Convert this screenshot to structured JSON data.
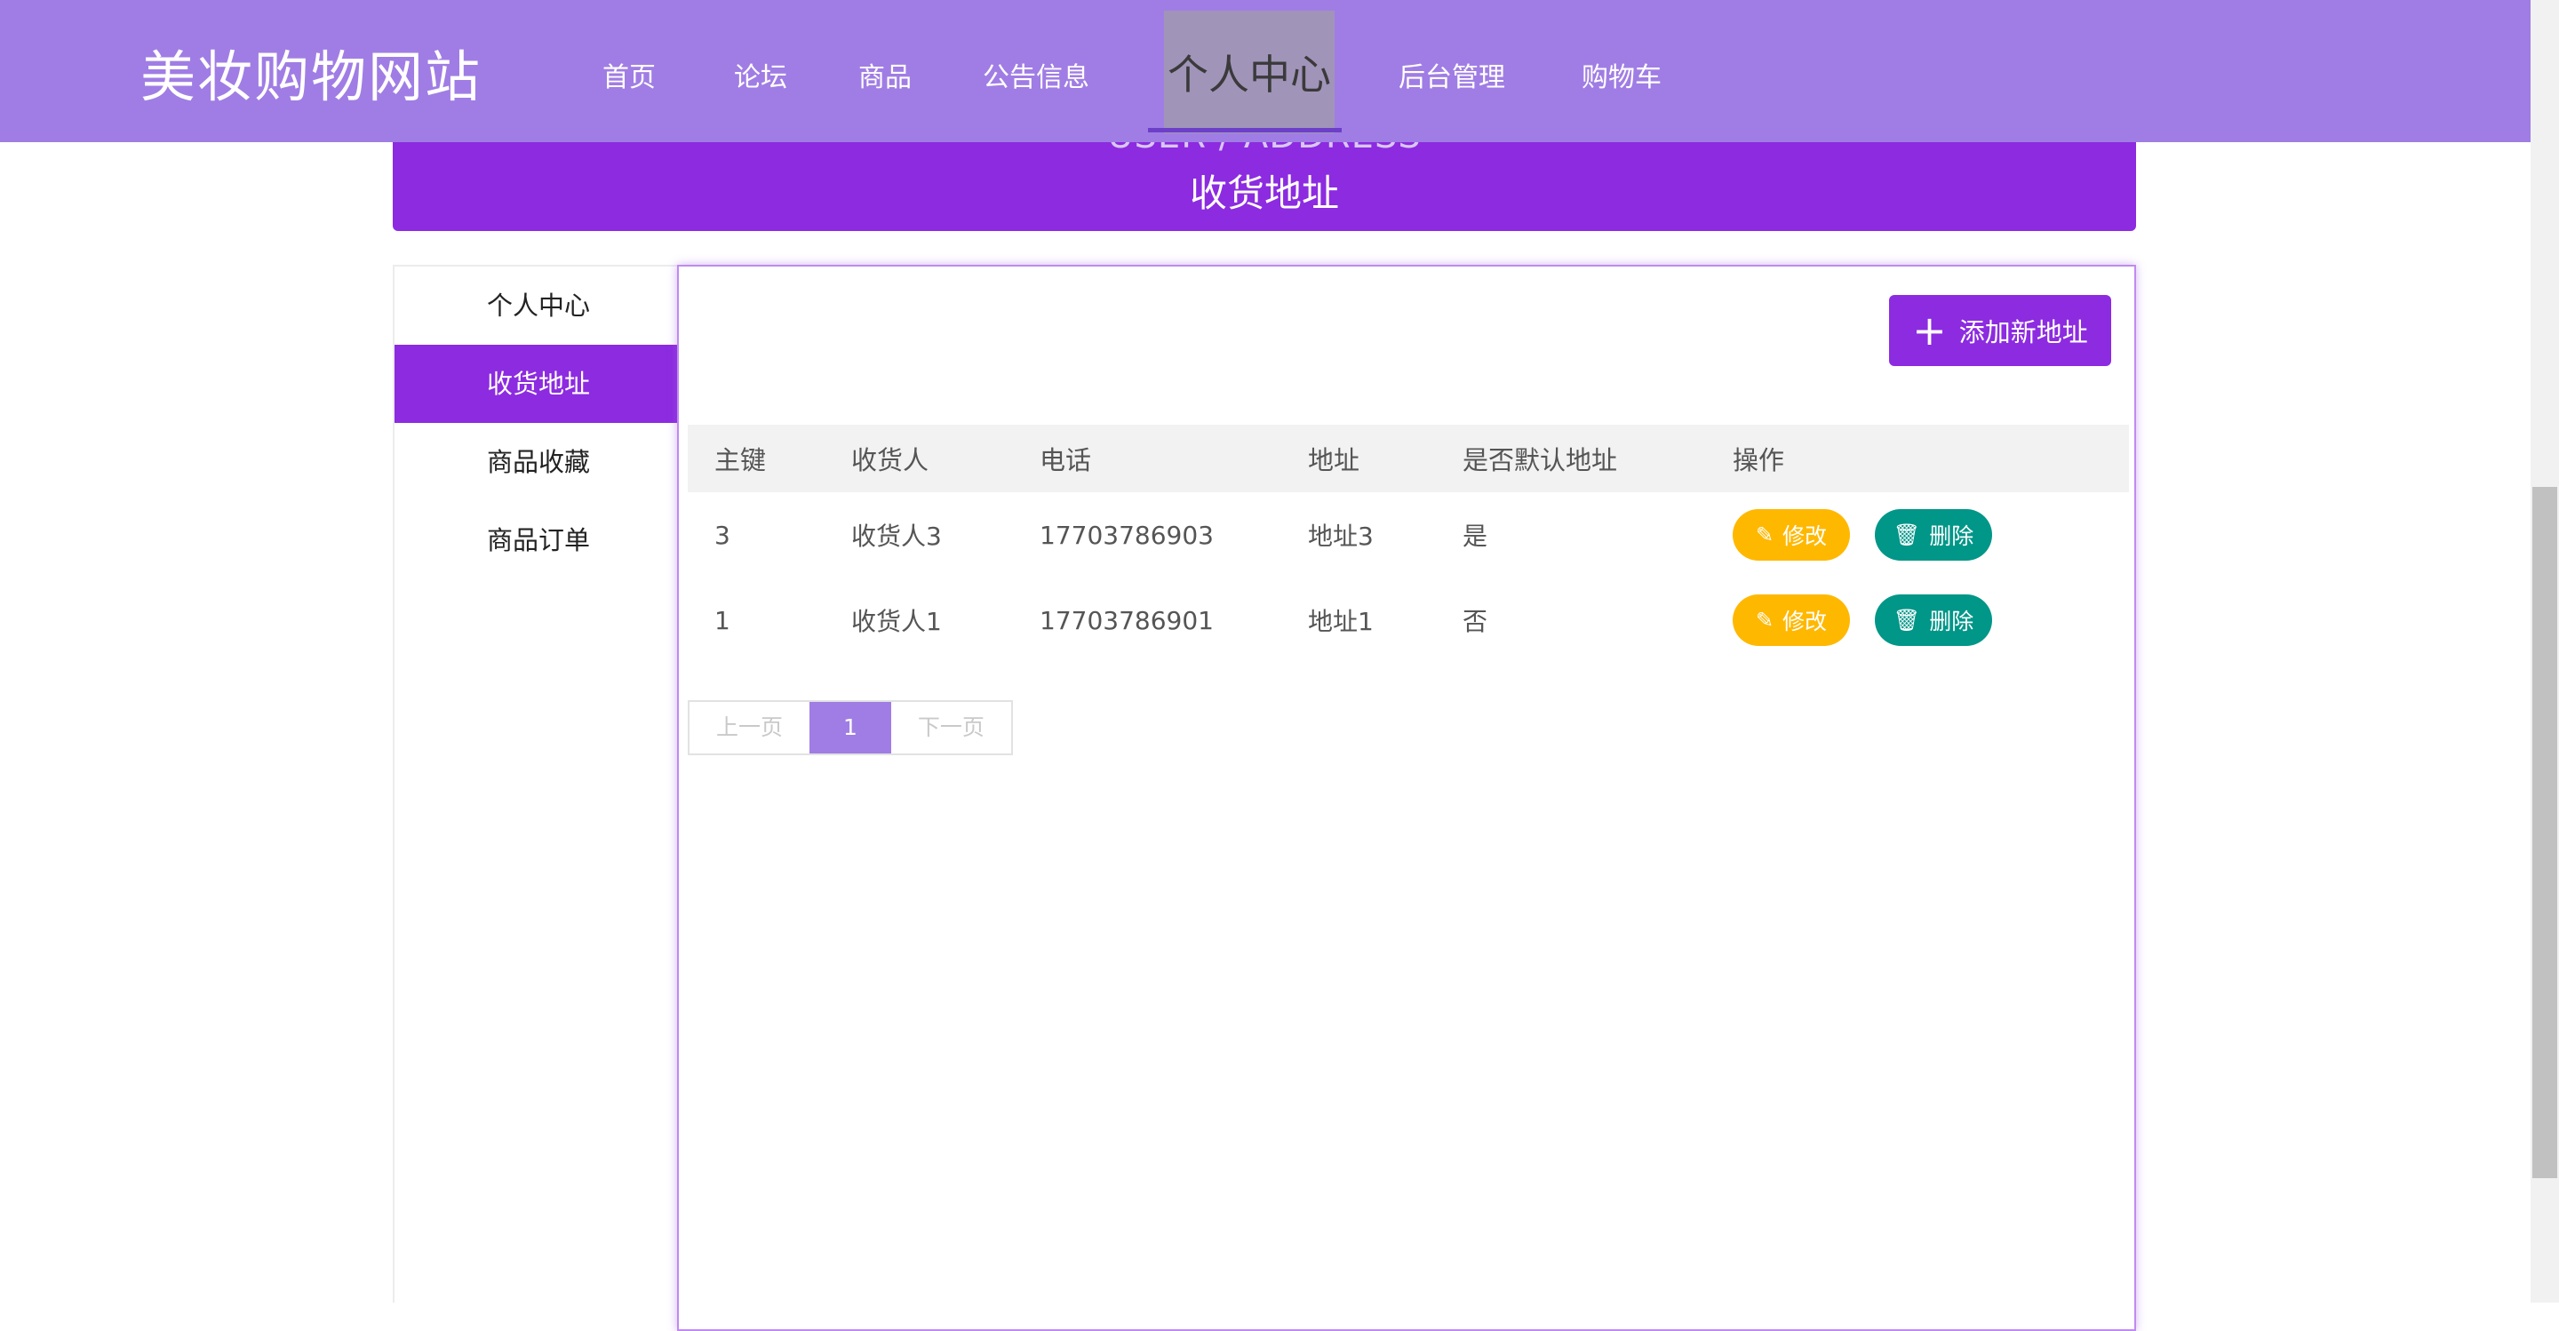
{
  "header": {
    "brand": "美妆购物网站",
    "nav": [
      {
        "label": "首页"
      },
      {
        "label": "论坛"
      },
      {
        "label": "商品"
      },
      {
        "label": "公告信息"
      },
      {
        "label": "个人中心",
        "active": true
      },
      {
        "label": "后台管理"
      },
      {
        "label": "购物车"
      }
    ]
  },
  "banner": {
    "subtitle": "USER / ADDRESS",
    "title": "收货地址"
  },
  "side_menu": {
    "items": [
      {
        "label": "个人中心"
      },
      {
        "label": "收货地址",
        "active": true
      },
      {
        "label": "商品收藏"
      },
      {
        "label": "商品订单"
      }
    ]
  },
  "toolbar": {
    "add_label": "添加新地址"
  },
  "table": {
    "columns": [
      "主键",
      "收货人",
      "电话",
      "地址",
      "是否默认地址",
      "操作"
    ],
    "rows": [
      {
        "id": "3",
        "name": "收货人3",
        "phone": "17703786903",
        "address": "地址3",
        "is_default": "是"
      },
      {
        "id": "1",
        "name": "收货人1",
        "phone": "17703786901",
        "address": "地址1",
        "is_default": "否"
      }
    ],
    "edit_label": "修改",
    "delete_label": "删除"
  },
  "pagination": {
    "prev": "上一页",
    "current": "1",
    "next": "下一页"
  },
  "colors": {
    "topbar": "#a07de4",
    "brand_purple": "#8c2be0",
    "edit": "#ffb800",
    "delete": "#009688"
  }
}
